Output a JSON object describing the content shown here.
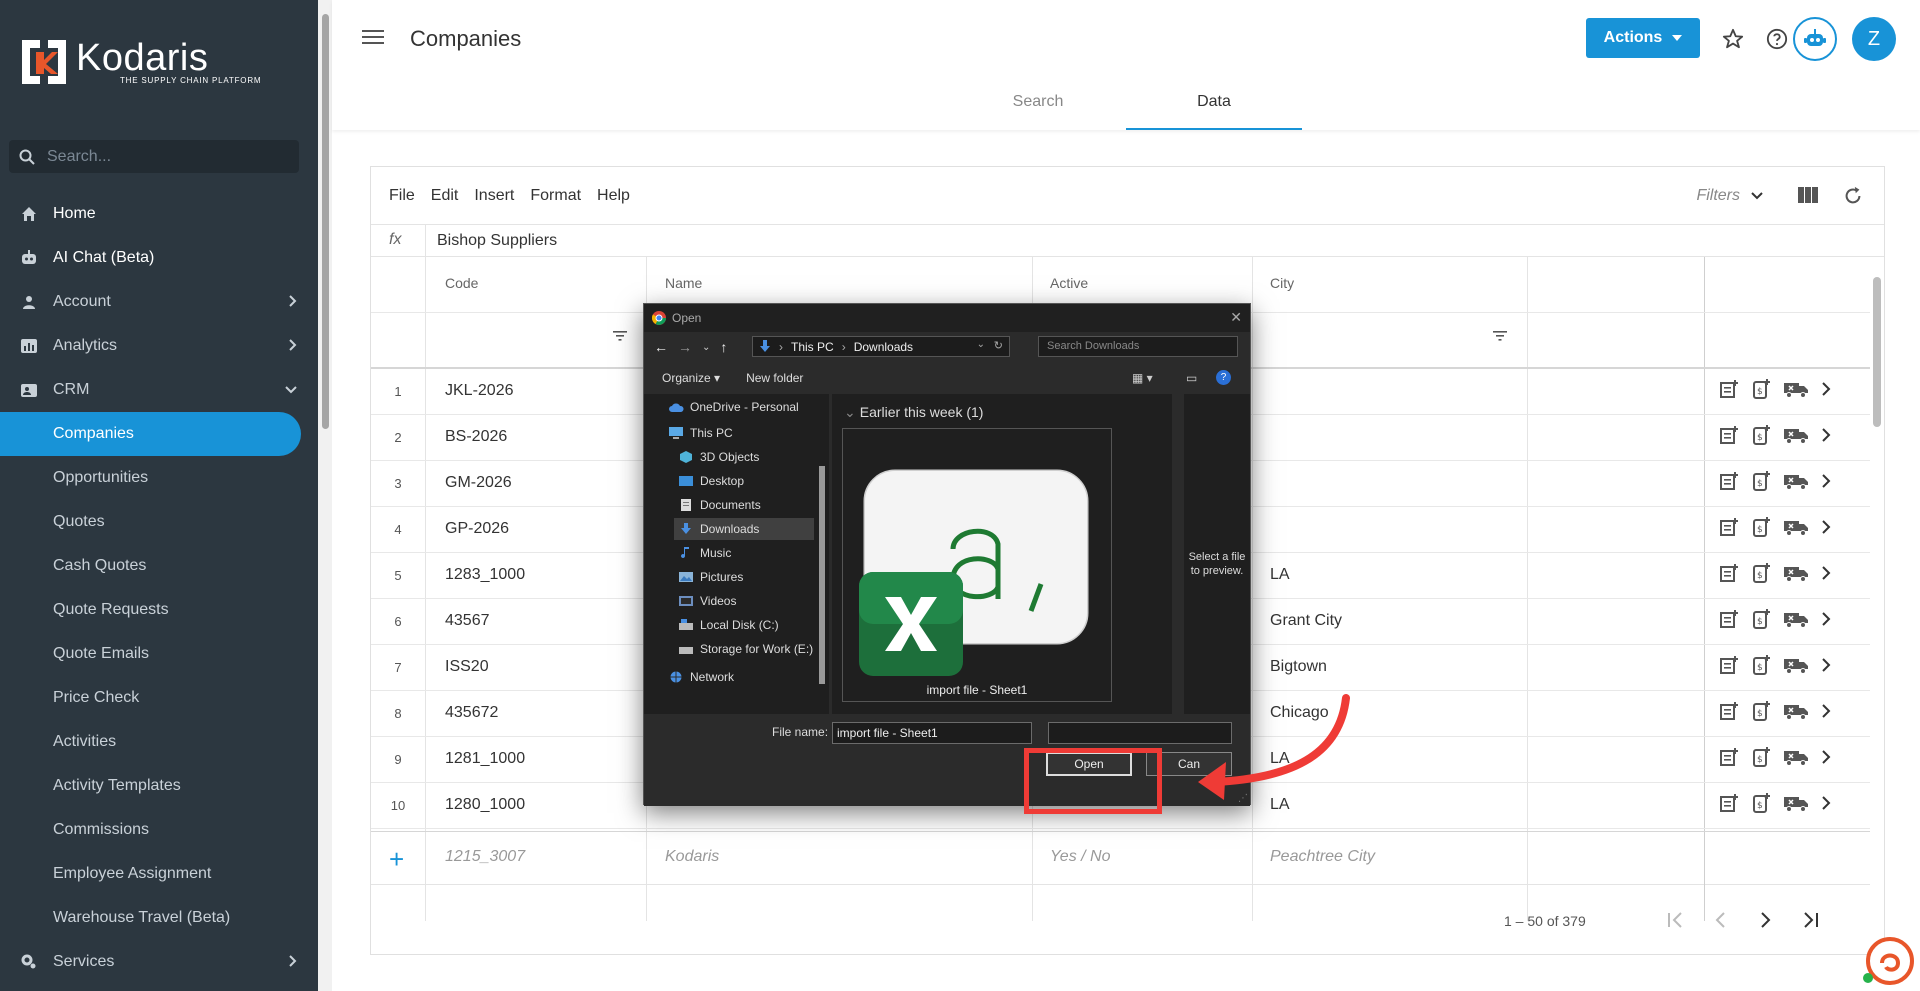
{
  "sidebar": {
    "brand": "Kodaris",
    "tagline": "THE SUPPLY CHAIN PLATFORM",
    "search_placeholder": "Search...",
    "items": [
      {
        "label": "Home",
        "icon": "home-icon"
      },
      {
        "label": "AI Chat (Beta)",
        "icon": "robot-icon"
      },
      {
        "label": "Account",
        "icon": "account-icon"
      },
      {
        "label": "Analytics",
        "icon": "analytics-icon"
      },
      {
        "label": "CRM",
        "icon": "crm-icon"
      },
      {
        "label": "Companies"
      },
      {
        "label": "Opportunities"
      },
      {
        "label": "Quotes"
      },
      {
        "label": "Cash Quotes"
      },
      {
        "label": "Quote Requests"
      },
      {
        "label": "Quote Emails"
      },
      {
        "label": "Price Check"
      },
      {
        "label": "Activities"
      },
      {
        "label": "Activity Templates"
      },
      {
        "label": "Commissions"
      },
      {
        "label": "Employee Assignment"
      },
      {
        "label": "Warehouse Travel (Beta)"
      },
      {
        "label": "Services",
        "icon": "services-icon"
      }
    ]
  },
  "header": {
    "title": "Companies",
    "actions_label": "Actions",
    "avatar_initial": "Z",
    "tabs": [
      {
        "label": "Search"
      },
      {
        "label": "Data"
      }
    ]
  },
  "sheet": {
    "menu": [
      "File",
      "Edit",
      "Insert",
      "Format",
      "Help"
    ],
    "filters_label": "Filters",
    "fx_label": "fx",
    "fx_value": "Bishop Suppliers",
    "columns": [
      "Code",
      "Name",
      "Active",
      "City"
    ],
    "rows": [
      {
        "num": "1",
        "code": "JKL-2026",
        "city": ""
      },
      {
        "num": "2",
        "code": "BS-2026",
        "city": ""
      },
      {
        "num": "3",
        "code": "GM-2026",
        "city": ""
      },
      {
        "num": "4",
        "code": "GP-2026",
        "city": ""
      },
      {
        "num": "5",
        "code": "1283_1000",
        "city": "LA"
      },
      {
        "num": "6",
        "code": "43567",
        "city": "Grant City"
      },
      {
        "num": "7",
        "code": "ISS20",
        "city": "Bigtown"
      },
      {
        "num": "8",
        "code": "435672",
        "city": "Chicago"
      },
      {
        "num": "9",
        "code": "1281_1000",
        "city": "LA"
      },
      {
        "num": "10",
        "code": "1280_1000",
        "city": "LA"
      }
    ],
    "new_row": {
      "code": "1215_3007",
      "name": "Kodaris",
      "active": "Yes / No",
      "city": "Peachtree City"
    },
    "pager_text": "1 – 50 of 379"
  },
  "dialog": {
    "title": "Open",
    "path": [
      "This PC",
      "Downloads"
    ],
    "search_placeholder": "Search Downloads",
    "organize_label": "Organize",
    "new_folder_label": "New folder",
    "nav_items": [
      {
        "label": "OneDrive - Personal"
      },
      {
        "label": "This PC"
      },
      {
        "label": "3D Objects"
      },
      {
        "label": "Desktop"
      },
      {
        "label": "Documents"
      },
      {
        "label": "Downloads"
      },
      {
        "label": "Music"
      },
      {
        "label": "Pictures"
      },
      {
        "label": "Videos"
      },
      {
        "label": "Local Disk (C:)"
      },
      {
        "label": "Storage for Work (E:)"
      },
      {
        "label": "Network"
      }
    ],
    "group_header": "Earlier this week (1)",
    "file_label": "import file - Sheet1",
    "preview_text": "Select a file to preview.",
    "filename_label": "File name:",
    "filename_value": "import file - Sheet1",
    "open_label": "Open",
    "cancel_label": "Can"
  },
  "colors": {
    "accent": "#1893d7",
    "sidebar_bg": "#2c3740",
    "annotation_red": "#ef3b36"
  }
}
